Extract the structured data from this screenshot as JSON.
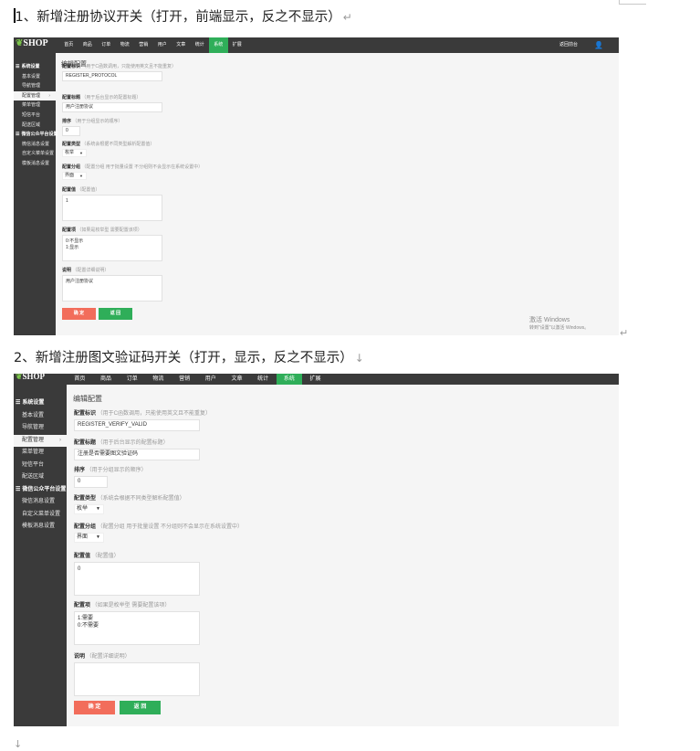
{
  "doc": {
    "heading1": "1、新增注册协议开关（打开，前端显示，反之不显示）",
    "heading2": "2、新增注册图文验证码开关（打开，显示，反之不显示）",
    "para_mark": "↵",
    "line_mark": "↓"
  },
  "screenshot1": {
    "logo": "SHOP",
    "nav": [
      "首页",
      "商品",
      "订单",
      "物流",
      "营销",
      "用户",
      "文章",
      "统计",
      "系统",
      "扩展"
    ],
    "active_nav": "系统",
    "return_link": "返回前台",
    "sidebar": [
      {
        "label": "系统设置",
        "group": true
      },
      {
        "label": "基本设置"
      },
      {
        "label": "导航管理"
      },
      {
        "label": "配置管理",
        "active": true
      },
      {
        "label": "菜单管理"
      },
      {
        "label": "短信平台"
      },
      {
        "label": "配送区域"
      },
      {
        "label": "微信公众平台设置",
        "group": true
      },
      {
        "label": "微信消息设置"
      },
      {
        "label": "自定义菜单设置"
      },
      {
        "label": "模板消息设置"
      }
    ],
    "page_title": "编辑配置",
    "fields": {
      "identifier_label": "配置标识",
      "identifier_hint": "（用于C函数调用，只能使用英文且不能重复）",
      "identifier_value": "REGISTER_PROTOCOL",
      "title_label": "配置标题",
      "title_hint": "（用于后台显示的配置标题）",
      "title_value": "用户注册协议",
      "sort_label": "排序",
      "sort_hint": "（用于分组显示的顺序）",
      "sort_value": "0",
      "type_label": "配置类型",
      "type_hint": "（系统会根据不同类型解析配置值）",
      "type_value": "枚举",
      "group_label": "配置分组",
      "group_hint": "（配置分组 用于批量设置 不分组则不会显示在系统设置中）",
      "group_value": "界面",
      "value_label": "配置值",
      "value_hint": "（配置值）",
      "value_value": "1",
      "items_label": "配置项",
      "items_hint": "（如果是枚举型 需要配置该项）",
      "items_value": "0:不显示\n1:显示",
      "desc_label": "说明",
      "desc_hint": "（配置详细说明）",
      "desc_value": "用户注册协议"
    },
    "ok_button": "确 定",
    "back_button": "返 回",
    "watermark_line1": "激活 Windows",
    "watermark_line2": "转到\"设置\"以激活 Windows。"
  },
  "screenshot2": {
    "logo": "SHOP",
    "nav": [
      "首页",
      "商品",
      "订单",
      "物流",
      "营销",
      "用户",
      "文章",
      "统计",
      "系统",
      "扩展"
    ],
    "active_nav": "系统",
    "sidebar": [
      {
        "label": "系统设置",
        "group": true
      },
      {
        "label": "基本设置"
      },
      {
        "label": "导航管理"
      },
      {
        "label": "配置管理",
        "active": true
      },
      {
        "label": "菜单管理"
      },
      {
        "label": "短信平台"
      },
      {
        "label": "配送区域"
      },
      {
        "label": "微信公众平台设置",
        "group": true
      },
      {
        "label": "微信消息设置"
      },
      {
        "label": "自定义菜单设置"
      },
      {
        "label": "模板消息设置"
      }
    ],
    "page_title": "编辑配置",
    "fields": {
      "identifier_label": "配置标识",
      "identifier_hint": "（用于C函数调用，只能使用英文且不能重复）",
      "identifier_value": "REGISTER_VERIFY_VALID",
      "title_label": "配置标题",
      "title_hint": "（用于后台显示的配置标题）",
      "title_value": "注册是否需要图文验证码",
      "sort_label": "排序",
      "sort_hint": "（用于分组显示的顺序）",
      "sort_value": "0",
      "type_label": "配置类型",
      "type_hint": "（系统会根据不同类型解析配置值）",
      "type_value": "枚举",
      "group_label": "配置分组",
      "group_hint": "（配置分组 用于批量设置 不分组则不会显示在系统设置中）",
      "group_value": "界面",
      "value_label": "配置值",
      "value_hint": "（配置值）",
      "value_value": "0",
      "items_label": "配置项",
      "items_hint": "（如果是枚举型 需要配置该项）",
      "items_value": "1:需要\n0:不需要",
      "desc_label": "说明",
      "desc_hint": "（配置详细说明）",
      "desc_value": ""
    },
    "ok_button": "确 定",
    "back_button": "返 回"
  }
}
